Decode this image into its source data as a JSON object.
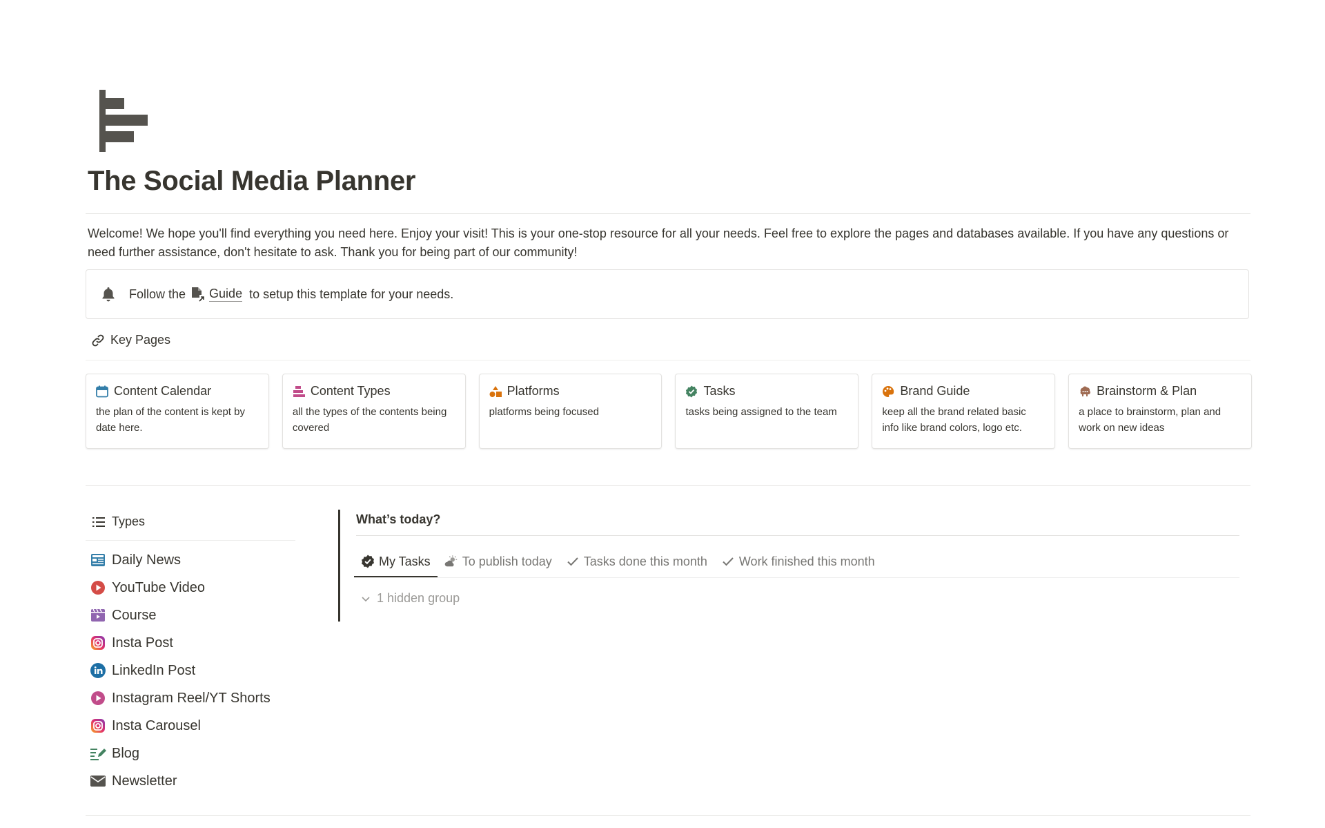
{
  "page": {
    "title": "The Social Media Planner",
    "icon": "bar-chart-icon",
    "intro": "Welcome! We hope you'll find everything you need here. Enjoy your visit! This is your one-stop resource for all your needs. Feel free to explore the pages and databases available. If you have any questions or need further assistance, don't hesitate to ask. Thank you for being part of our community!"
  },
  "callout": {
    "icon": "bell-icon",
    "before": "Follow the",
    "link": "Guide",
    "after": "to setup this template for your needs."
  },
  "key_pages": {
    "heading": "Key Pages",
    "icon": "link-icon",
    "cards": [
      {
        "title": "Content Calendar",
        "desc": "the plan of the content is kept by date here.",
        "icon": "calendar-icon"
      },
      {
        "title": "Content Types",
        "desc": "all the types of the contents being covered",
        "icon": "stack-icon"
      },
      {
        "title": "Platforms",
        "desc": "platforms being focused",
        "icon": "shapes-icon"
      },
      {
        "title": "Tasks",
        "desc": "tasks being assigned to the team",
        "icon": "check-badge-icon"
      },
      {
        "title": "Brand Guide",
        "desc": "keep all the brand related basic info like brand colors, logo etc.",
        "icon": "palette-icon"
      },
      {
        "title": "Brainstorm & Plan",
        "desc": "a place to brainstorm, plan and work on new ideas",
        "icon": "brain-icon"
      }
    ]
  },
  "types": {
    "heading": "Types",
    "icon": "list-icon",
    "items": [
      {
        "label": "Daily News",
        "icon": "newspaper-icon"
      },
      {
        "label": "YouTube Video",
        "icon": "play-circle-icon"
      },
      {
        "label": "Course",
        "icon": "film-icon"
      },
      {
        "label": "Insta Post",
        "icon": "instagram-icon"
      },
      {
        "label": "LinkedIn Post",
        "icon": "linkedin-icon"
      },
      {
        "label": "Instagram Reel/YT Shorts",
        "icon": "play-circle-icon"
      },
      {
        "label": "Insta Carousel",
        "icon": "instagram-icon"
      },
      {
        "label": "Blog",
        "icon": "pen-lines-icon"
      },
      {
        "label": "Newsletter",
        "icon": "envelope-icon"
      }
    ]
  },
  "today": {
    "title": "What’s today?",
    "tabs": [
      {
        "label": "My Tasks",
        "icon": "check-badge-icon",
        "active": true
      },
      {
        "label": "To publish today",
        "icon": "sun-cloud-icon",
        "active": false
      },
      {
        "label": "Tasks done this month",
        "icon": "check-icon",
        "active": false
      },
      {
        "label": "Work finished this month",
        "icon": "check-icon",
        "active": false
      }
    ],
    "hidden_group": "1 hidden group"
  },
  "colors": {
    "text": "#37352f",
    "muted": "#787774",
    "calendar": "#337ea9",
    "pink": "#c14c8a",
    "orange": "#d9730d",
    "green": "#448361",
    "brown": "#9f6b53",
    "red": "#d44c47",
    "purple": "#9065b0",
    "linkedin": "#0a66c2"
  }
}
